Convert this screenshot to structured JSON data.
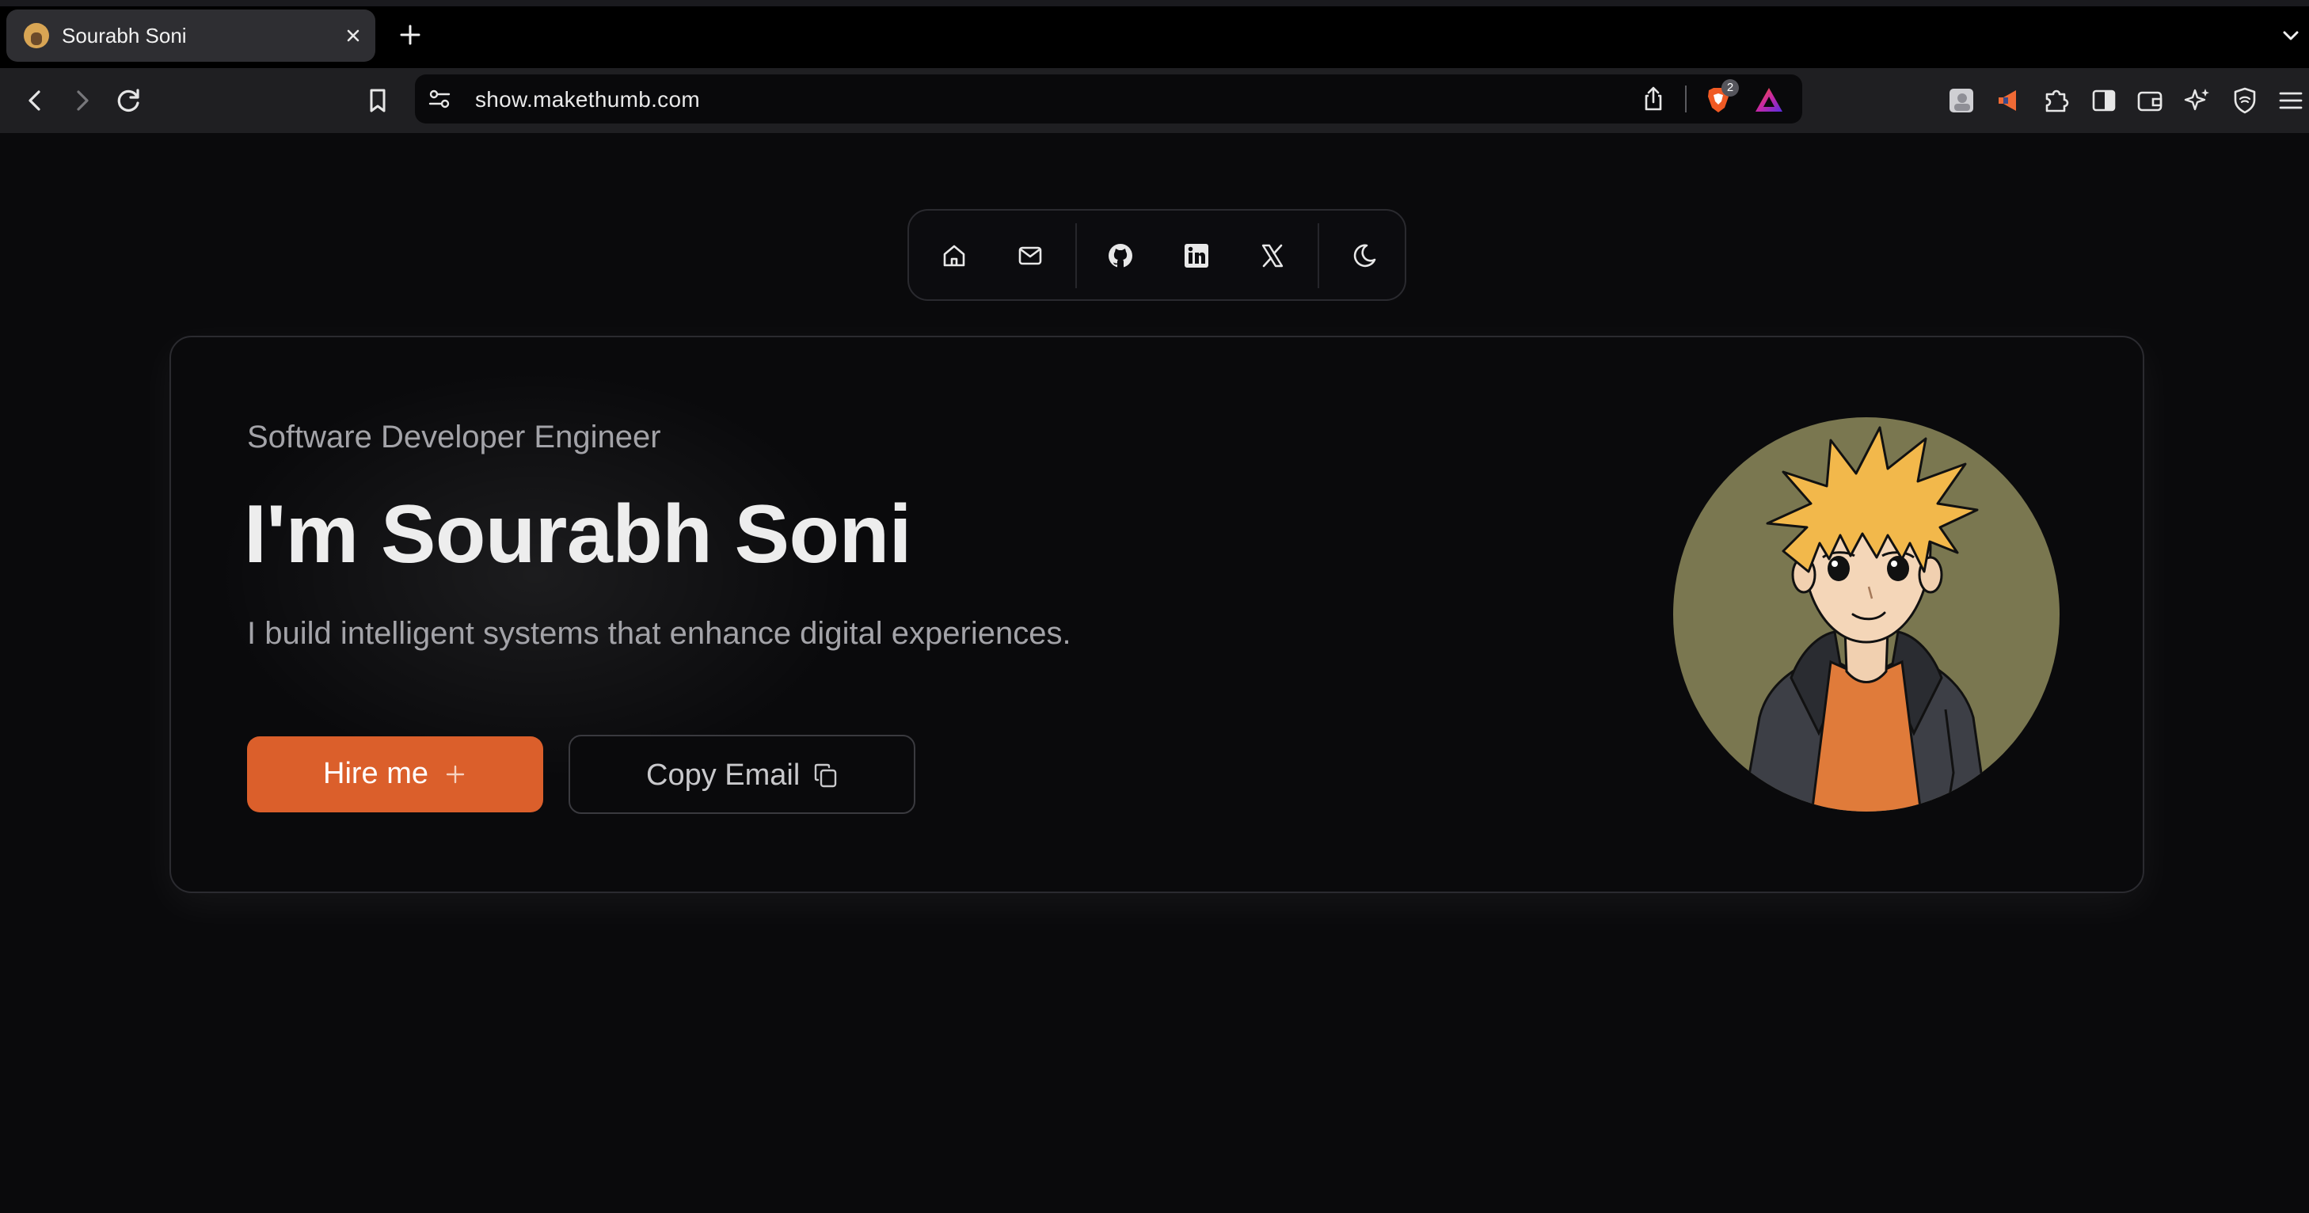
{
  "browser": {
    "tab": {
      "title": "Sourabh Soni",
      "favicon": "avatar-favicon"
    },
    "address": {
      "url": "show.makethumb.com"
    },
    "shields_badge": "2",
    "icons": [
      "back-icon",
      "forward-icon",
      "reload-icon",
      "bookmark-icon",
      "site-settings-icon",
      "share-icon",
      "brave-shield-icon",
      "brave-rewards-icon",
      "extension-icon",
      "extensions-puzzle-icon",
      "sidebar-icon",
      "wallet-icon",
      "leo-ai-icon",
      "vpn-icon",
      "menu-icon"
    ]
  },
  "nav": {
    "items": [
      "home-icon",
      "mail-icon",
      "github-icon",
      "linkedin-icon",
      "x-icon",
      "moon-icon"
    ]
  },
  "hero": {
    "subtitle": "Software Developer Engineer",
    "headline": "I'm Sourabh Soni",
    "tagline": "I build intelligent systems that enhance digital experiences.",
    "primary_button": "Hire me",
    "secondary_button": "Copy Email"
  },
  "colors": {
    "page_bg": "#0a0a0c",
    "accent": "#db5f2b",
    "avatar_bg": "#7a7750",
    "text_primary": "#ededed",
    "text_muted": "#a3a3a8"
  }
}
